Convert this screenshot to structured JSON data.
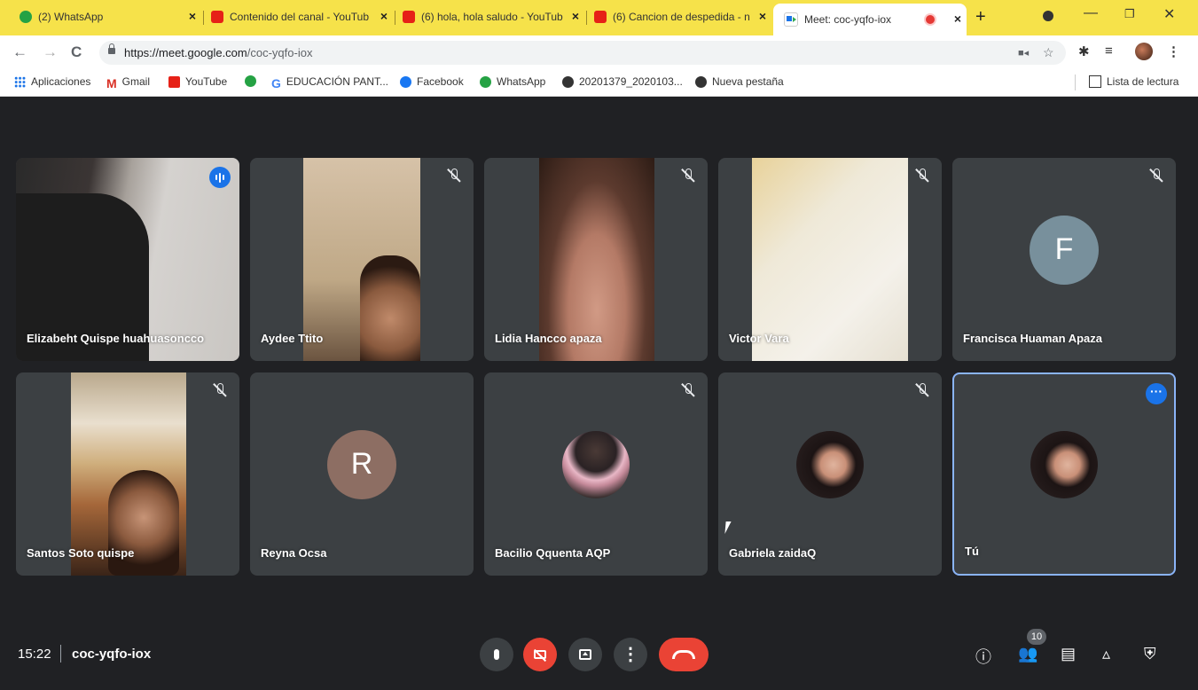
{
  "browser": {
    "tabs": [
      {
        "label": "(2) WhatsApp",
        "icon": "whatsapp-icon"
      },
      {
        "label": "Contenido del canal - YouTub",
        "icon": "youtube-icon"
      },
      {
        "label": "(6) hola, hola saludo - YouTub",
        "icon": "youtube-icon"
      },
      {
        "label": "(6) Cancion de despedida - n",
        "icon": "youtube-icon"
      },
      {
        "label": "Meet: coc-yqfo-iox",
        "icon": "meet-icon"
      }
    ],
    "new_tab": "+",
    "close_glyph": "×",
    "url_host": "https://meet.google.com",
    "url_path": "/coc-yqfo-iox",
    "bookmarks": [
      {
        "label": "Aplicaciones",
        "icon": "apps"
      },
      {
        "label": "Gmail",
        "icon": "gmail",
        "glyph": "M"
      },
      {
        "label": "YouTube",
        "icon": "yt"
      },
      {
        "label": "",
        "icon": "wa"
      },
      {
        "label": "EDUCACIÓN PANT...",
        "icon": "g",
        "glyph": "G"
      },
      {
        "label": "Facebook",
        "icon": "fb"
      },
      {
        "label": "WhatsApp",
        "icon": "wa"
      },
      {
        "label": "20201379_2020103...",
        "icon": "globe"
      },
      {
        "label": "Nueva pestaña",
        "icon": "globe"
      }
    ],
    "reading_list": "Lista de lectura"
  },
  "meet": {
    "participants": [
      {
        "name": "Elizabeht Quispe huahuasoncco",
        "state": "speaking"
      },
      {
        "name": "Aydee Ttito",
        "state": "muted"
      },
      {
        "name": "Lidia Hancco apaza",
        "state": "muted"
      },
      {
        "name": "Victor Vara",
        "state": "muted"
      },
      {
        "name": "Francisca Huaman Apaza",
        "state": "muted",
        "avatar_letter": "F",
        "avatar_color": "#78909c"
      },
      {
        "name": "Santos Soto quispe",
        "state": "muted"
      },
      {
        "name": "Reyna Ocsa",
        "state": "on",
        "avatar_letter": "R",
        "avatar_color": "#8d6e63"
      },
      {
        "name": "Bacilio Qquenta AQP",
        "state": "muted"
      },
      {
        "name": "Gabriela zaidaQ",
        "state": "muted"
      },
      {
        "name": "Tú",
        "state": "self"
      }
    ],
    "time": "15:22",
    "meeting_code": "coc-yqfo-iox",
    "participant_count": "10",
    "accent_color": "#1a73e8",
    "end_color": "#ea4335"
  }
}
